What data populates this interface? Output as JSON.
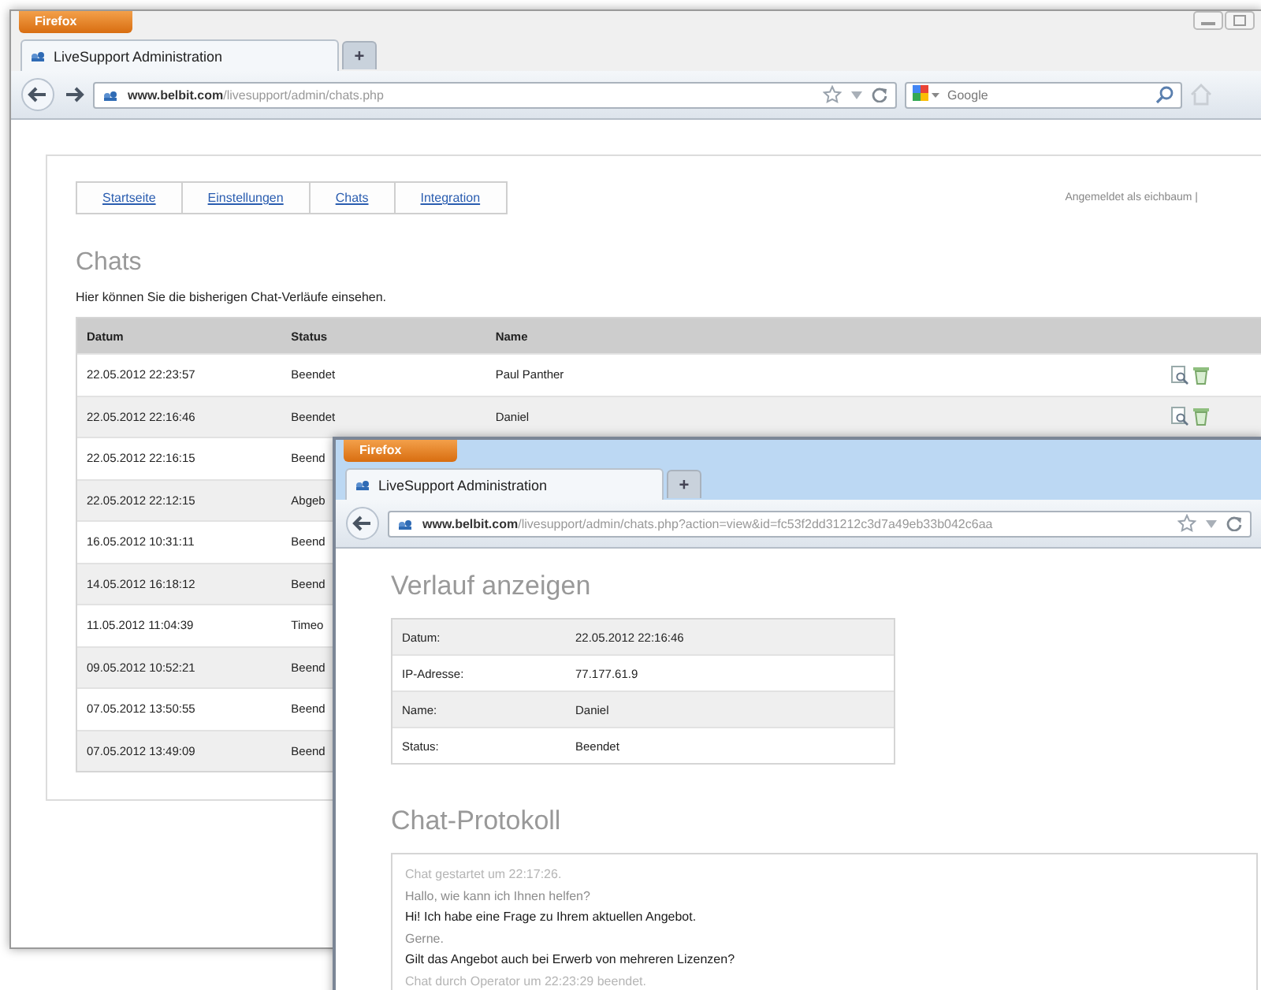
{
  "back_window": {
    "browser_button": "Firefox",
    "tab": {
      "title": "LiveSupport Administration",
      "selected": true
    },
    "new_tab": "+",
    "address": {
      "domain": "www.belbit.com",
      "path": "/livesupport/admin/chats.php"
    },
    "search": {
      "placeholder": "Google"
    },
    "page": {
      "nav": [
        "Startseite",
        "Einstellungen",
        "Chats",
        "Integration"
      ],
      "login": "Angemeldet als eichbaum |",
      "heading": "Chats",
      "intro": "Hier können Sie die bisherigen Chat-Verläufe einsehen.",
      "columns": [
        "Datum",
        "Status",
        "Name"
      ],
      "rows": [
        {
          "date": "22.05.2012 22:23:57",
          "status": "Beendet",
          "name": "Paul Panther"
        },
        {
          "date": "22.05.2012 22:16:46",
          "status": "Beendet",
          "name": "Daniel"
        },
        {
          "date": "22.05.2012 22:16:15",
          "status": "Beend"
        },
        {
          "date": "22.05.2012 22:12:15",
          "status": "Abgeb"
        },
        {
          "date": "16.05.2012 10:31:11",
          "status": "Beend"
        },
        {
          "date": "14.05.2012 16:18:12",
          "status": "Beend"
        },
        {
          "date": "11.05.2012 11:04:39",
          "status": "Timeo"
        },
        {
          "date": "09.05.2012 10:52:21",
          "status": "Beend"
        },
        {
          "date": "07.05.2012 13:50:55",
          "status": "Beend"
        },
        {
          "date": "07.05.2012 13:49:09",
          "status": "Beend"
        }
      ]
    }
  },
  "front_window": {
    "browser_button": "Firefox",
    "tab": {
      "title": "LiveSupport Administration",
      "selected": true
    },
    "new_tab": "+",
    "address": {
      "domain": "www.belbit.com",
      "path": "/livesupport/admin/chats.php?action=view&id=fc53f2dd31212c3d7a49eb33b042c6aa"
    },
    "page": {
      "heading": "Verlauf anzeigen",
      "details": [
        {
          "label": "Datum:",
          "value": "22.05.2012 22:16:46"
        },
        {
          "label": "IP-Adresse:",
          "value": "77.177.61.9"
        },
        {
          "label": "Name:",
          "value": "Daniel"
        },
        {
          "label": "Status:",
          "value": "Beendet"
        }
      ],
      "log_heading": "Chat-Protokoll",
      "log": [
        {
          "kind": "system",
          "text": "Chat gestartet um 22:17:26."
        },
        {
          "kind": "operator",
          "text": "Hallo, wie kann ich Ihnen helfen?"
        },
        {
          "kind": "visitor",
          "text": "Hi! Ich habe eine Frage zu Ihrem aktuellen Angebot."
        },
        {
          "kind": "operator",
          "text": "Gerne."
        },
        {
          "kind": "visitor",
          "text": "Gilt das Angebot auch bei Erwerb von mehreren Lizenzen?"
        },
        {
          "kind": "system",
          "text": "Chat durch Operator um 22:23:29 beendet."
        }
      ]
    }
  }
}
